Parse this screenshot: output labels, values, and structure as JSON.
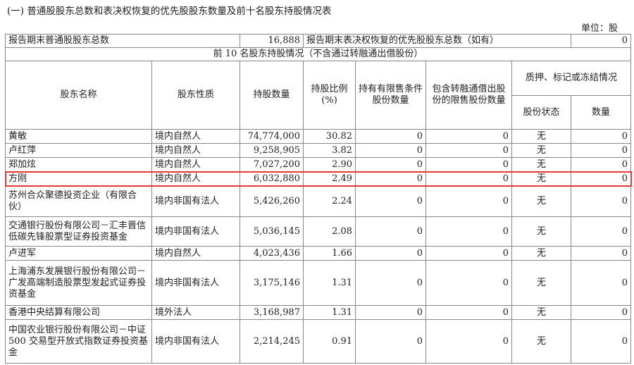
{
  "title": "(一) 普通股股东总数和表决权恢复的优先股股东数量及前十名股东持股情况表",
  "unit": "单位：股",
  "summary": {
    "total_label": "报告期末普通股股东总数",
    "total_value": "16,888",
    "pref_label": "报告期末表决权恢复的优先股股东总数（如有）",
    "pref_value": "0"
  },
  "section_title": "前 10 名股东持股情况（不含通过转融通出借股份）",
  "headers": {
    "name": "股东名称",
    "nature": "股东性质",
    "shares": "持股数量",
    "ratio": "持股比例(%)",
    "restricted": "持有有限售条件股份数量",
    "lending": "包含转融通借出股份的限售股份数量",
    "pledge": "质押、标记或冻结情况",
    "pledge_status": "股份状态",
    "pledge_qty": "数量"
  },
  "rows": [
    {
      "name": "黄敏",
      "nature": "境内自然人",
      "shares": "74,774,000",
      "ratio": "30.82",
      "restricted": "0",
      "lending": "0",
      "status": "无",
      "qty": "0"
    },
    {
      "name": "卢红萍",
      "nature": "境内自然人",
      "shares": "9,258,905",
      "ratio": "3.82",
      "restricted": "0",
      "lending": "0",
      "status": "无",
      "qty": "0"
    },
    {
      "name": "郑加炫",
      "nature": "境内自然人",
      "shares": "7,027,200",
      "ratio": "2.90",
      "restricted": "0",
      "lending": "0",
      "status": "无",
      "qty": "0"
    },
    {
      "name": "方刚",
      "nature": "境内自然人",
      "shares": "6,032,880",
      "ratio": "2.49",
      "restricted": "0",
      "lending": "0",
      "status": "无",
      "qty": "0"
    },
    {
      "name": "苏州合众聚德投资企业（有限合伙）",
      "nature": "境内非国有法人",
      "shares": "5,426,260",
      "ratio": "2.24",
      "restricted": "0",
      "lending": "0",
      "status": "无",
      "qty": "0"
    },
    {
      "name": "交通银行股份有限公司－汇丰晋信低碳先锋股票型证券投资基金",
      "nature": "境内非国有法人",
      "shares": "5,036,145",
      "ratio": "2.08",
      "restricted": "0",
      "lending": "0",
      "status": "无",
      "qty": "0"
    },
    {
      "name": "卢进军",
      "nature": "境内自然人",
      "shares": "4,023,436",
      "ratio": "1.66",
      "restricted": "0",
      "lending": "0",
      "status": "无",
      "qty": "0"
    },
    {
      "name": "上海浦东发展银行股份有限公司－广发高端制造股票型发起式证券投资基金",
      "nature": "境内非国有法人",
      "shares": "3,175,146",
      "ratio": "1.31",
      "restricted": "0",
      "lending": "0",
      "status": "无",
      "qty": "0"
    },
    {
      "name": "香港中央结算有限公司",
      "nature": "境外法人",
      "shares": "3,168,987",
      "ratio": "1.31",
      "restricted": "0",
      "lending": "0",
      "status": "无",
      "qty": "0"
    },
    {
      "name": "中国农业银行股份有限公司－中证 500 交易型开放式指数证券投资基金",
      "nature": "境内非国有法人",
      "shares": "2,214,245",
      "ratio": "0.91",
      "restricted": "0",
      "lending": "0",
      "status": "无",
      "qty": "0"
    }
  ],
  "highlight_color": "#e53935"
}
